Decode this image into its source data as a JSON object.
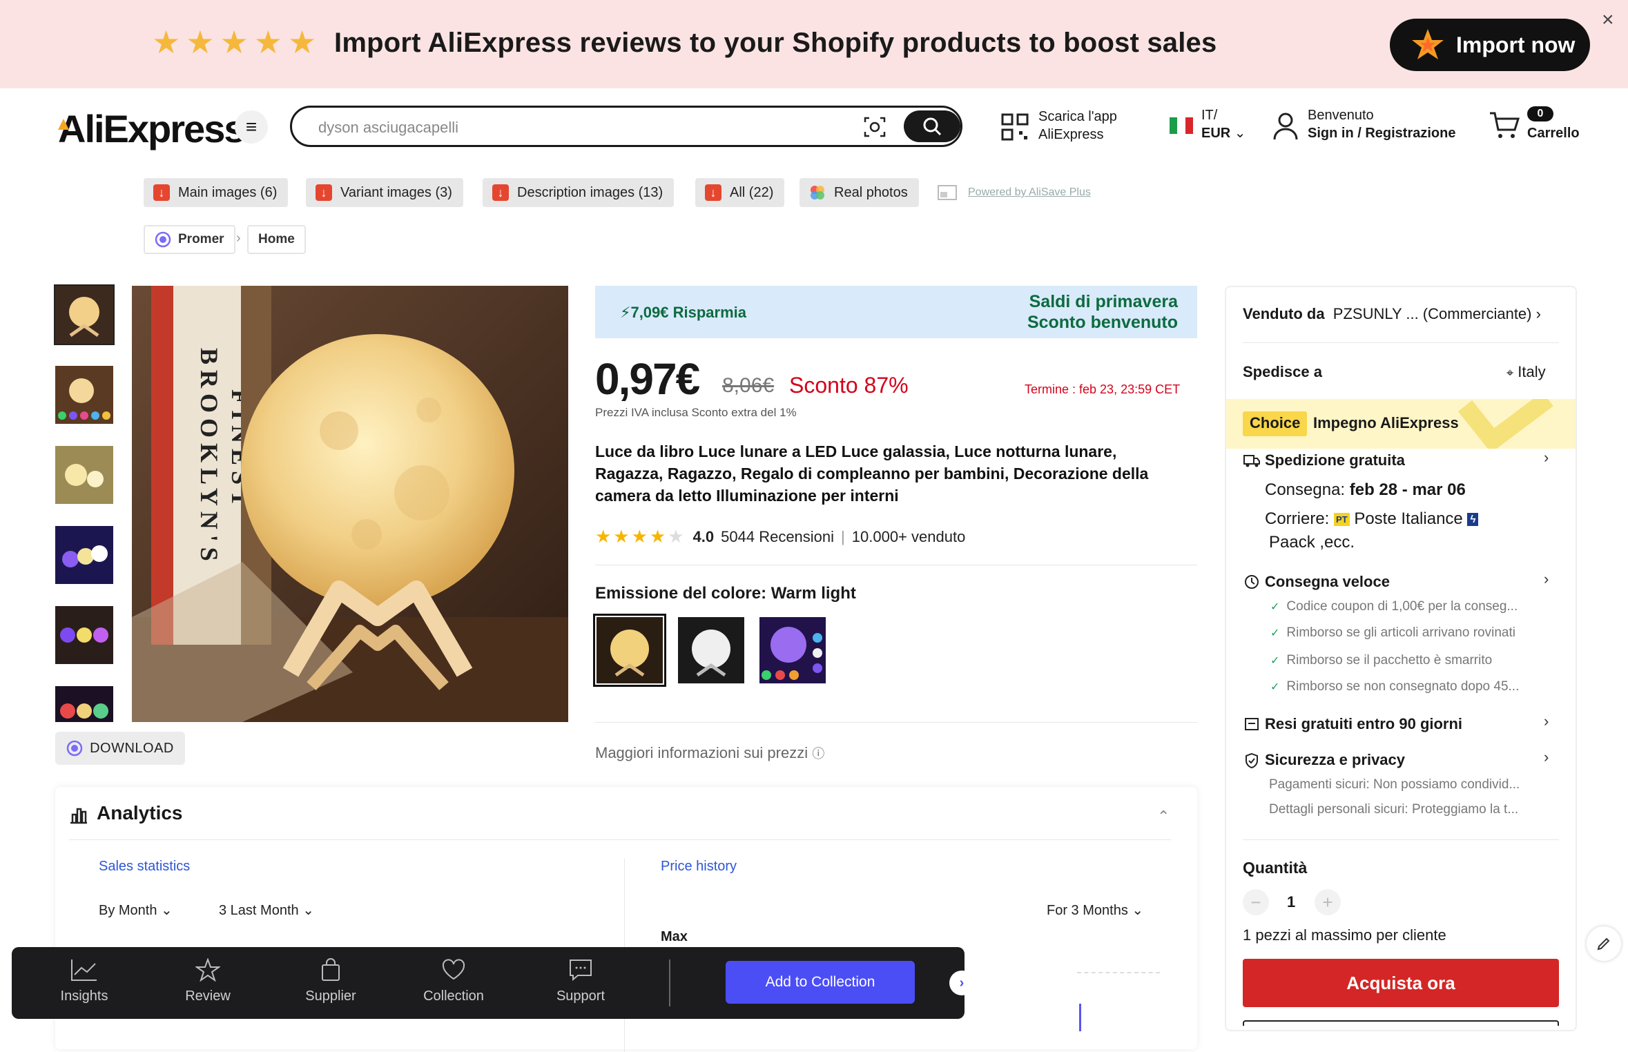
{
  "promo": {
    "text": "Import AliExpress reviews to your Shopify products to boost sales",
    "button": "Import now",
    "close": "×"
  },
  "header": {
    "logo": "AliExpress",
    "search_placeholder": "dyson asciugacapelli",
    "app_line1": "Scarica l'app",
    "app_line2": "AliExpress",
    "lang_line1": "IT/",
    "lang_line2": "EUR",
    "account_line1": "Benvenuto",
    "account_line2": "Sign in / Registrazione",
    "cart_count": "0",
    "cart_label": "Carrello"
  },
  "tools": {
    "chips": [
      "Main images (6)",
      "Variant images (3)",
      "Description images (13)",
      "All (22)",
      "Real photos"
    ],
    "powered": "Powered by AliSave Plus"
  },
  "breadcrumb": {
    "items": [
      "Promer",
      "Home"
    ],
    "sep": "›"
  },
  "gallery": {
    "download": "DOWNLOAD"
  },
  "product": {
    "save_text": "7,09€ Risparmia",
    "promo_line1": "Saldi di primavera",
    "promo_line2": "Sconto benvenuto",
    "price": "0,97€",
    "old_price": "8,06€",
    "discount": "Sconto 87%",
    "end_time": "Termine :  feb 23, 23:59 CET",
    "vat_note": "Prezzi IVA inclusa Sconto extra del 1%",
    "title": "Luce da libro Luce lunare a LED Luce galassia, Luce notturna lunare, Ragazza, Ragazzo, Regalo di compleanno per bambini, Decorazione della camera da letto Illuminazione per interni",
    "rating_value": "4.0",
    "rating_stars": 4,
    "reviews": "5044 Recensioni",
    "rating_sep": "|",
    "sold": "10.000+ venduto",
    "color_label": "Emissione del colore: Warm light",
    "more_info": "Maggiori informazioni sui prezzi"
  },
  "analytics": {
    "title": "Analytics",
    "sales_tab": "Sales statistics",
    "price_tab": "Price history",
    "by_month": "By Month",
    "last_month": "3 Last Month",
    "for_months": "For 3 Months",
    "max": "Max"
  },
  "seller": {
    "sold_by_label": "Venduto da",
    "sold_by_value": "PZSUNLY ... (Commerciante)",
    "ship_to_label": "Spedisce a",
    "ship_to_value": "Italy",
    "choice_tag": "Choice",
    "choice_text": "Impegno AliExpress",
    "free_ship": "Spedizione gratuita",
    "delivery_label": "Consegna:",
    "delivery_value": "feb 28 - mar 06",
    "courier_label": "Corriere:",
    "courier_value": "Poste Italiance",
    "courier_more": "Paack ,ecc.",
    "fast_delivery": "Consegna veloce",
    "fast_items": [
      "Codice coupon di 1,00€ per la conseg...",
      "Rimborso se gli articoli arrivano rovinati",
      "Rimborso se il pacchetto è smarrito",
      "Rimborso se non consegnato dopo 45..."
    ],
    "free_returns": "Resi gratuiti entro 90 giorni",
    "security": "Sicurezza e privacy",
    "security_items": [
      "Pagamenti sicuri: Non possiamo condivid...",
      "Dettagli personali sicuri: Proteggiamo la t..."
    ],
    "qty_label": "Quantità",
    "qty_value": "1",
    "qty_note": "1 pezzi al massimo per cliente",
    "buy_now": "Acquista ora"
  },
  "toolbar": {
    "items": [
      "Insights",
      "Review",
      "Supplier",
      "Collection",
      "Support"
    ],
    "add_collection": "Add to Collection"
  },
  "colors": {
    "accent_red": "#d3031c",
    "green": "#0d6b3f",
    "blue_btn": "#4b4ef5",
    "promo_bg": "#fbe3e3"
  }
}
